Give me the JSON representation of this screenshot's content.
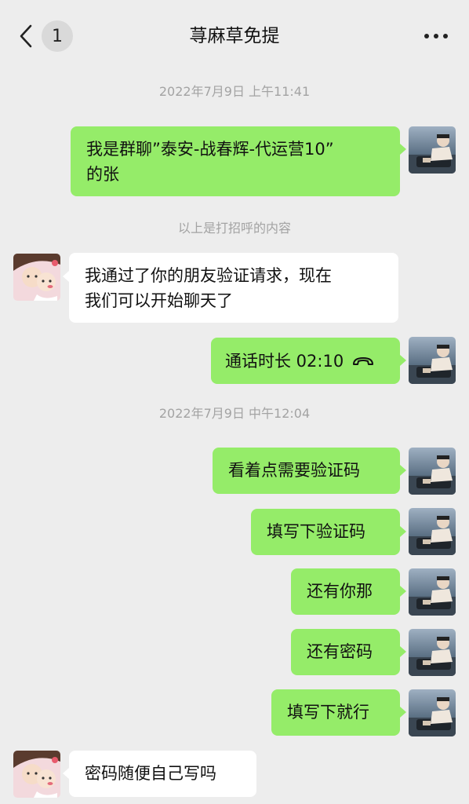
{
  "header": {
    "unread_count": "1",
    "title": "荨麻草免提",
    "back_icon": "chevron-left-icon",
    "more_icon": "more-dots-icon"
  },
  "timestamps": [
    "2022年7月9日 上午11:41",
    "2022年7月9日 中午12:04"
  ],
  "system_note": "以上是打招呼的内容",
  "messages": [
    {
      "side": "right",
      "lines": [
        "我是群聊”泰安-战春辉-代运营10”",
        "的张"
      ]
    },
    {
      "side": "left",
      "lines": [
        "我通过了你的朋友验证请求，现在",
        "我们可以开始聊天了"
      ]
    },
    {
      "side": "right",
      "type": "call",
      "text": "通话时长 02:10",
      "icon": "phone-hangup-icon"
    },
    {
      "side": "right",
      "text": "看着点需要验证码"
    },
    {
      "side": "right",
      "text": "填写下验证码"
    },
    {
      "side": "right",
      "text": "还有你那"
    },
    {
      "side": "right",
      "text": "还有密码"
    },
    {
      "side": "right",
      "text": "填写下就行"
    },
    {
      "side": "left",
      "text": "密码随便自己写吗"
    }
  ],
  "colors": {
    "background": "#ededed",
    "bubble_self": "#95ec69",
    "bubble_other": "#ffffff",
    "meta_text": "#a3a3a3"
  }
}
